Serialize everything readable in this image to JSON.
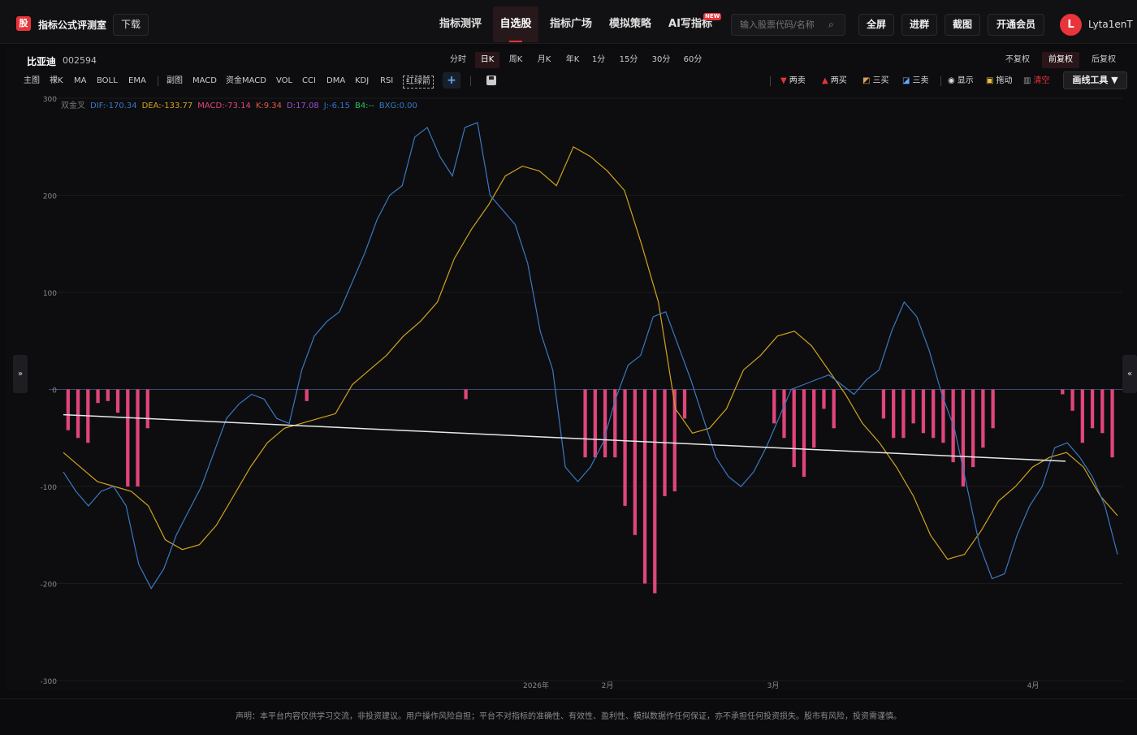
{
  "header": {
    "logo_char": "股",
    "brand": "指标公式评测室",
    "download": "下载",
    "nav": [
      "指标测评",
      "自选股",
      "指标广场",
      "模拟策略",
      "AI写指标"
    ],
    "nav_active": "自选股",
    "new_badge": "NEW",
    "search_placeholder": "输入股票代码/名称",
    "buttons": [
      "全屏",
      "进群",
      "截图",
      "开通会员"
    ],
    "avatar_letter": "L",
    "username": "Lyta1enT"
  },
  "stock": {
    "name": "比亚迪",
    "code": "002594"
  },
  "periods": [
    "分时",
    "日K",
    "周K",
    "月K",
    "年K",
    "1分",
    "15分",
    "30分",
    "60分"
  ],
  "period_active": "日K",
  "fuquan": [
    "不复权",
    "前复权",
    "后复权"
  ],
  "fuquan_active": "前复权",
  "indicators": [
    "主图",
    "裸K",
    "MA",
    "BOLL",
    "EMA",
    "副图",
    "MACD",
    "资金MACD",
    "VOL",
    "CCI",
    "DMA",
    "KDJ",
    "RSI",
    "红绿箭"
  ],
  "tools": {
    "two_sell": "两卖",
    "two_buy": "两买",
    "three_buy": "三买",
    "three_sell": "三卖",
    "show": "显示",
    "drag": "拖动",
    "clear": "清空",
    "draw_tools": "画线工具 ▼"
  },
  "legend": {
    "name": "双金叉",
    "dif": "DIF:-170.34",
    "dea": "DEA:-133.77",
    "macd": "MACD:-73.14",
    "k": "K:9.34",
    "d": "D:17.08",
    "j": "J:-6.15",
    "b4": "B4:--",
    "bxg": "BXG:0.00"
  },
  "colors": {
    "accent": "#e8343a",
    "dif": "#3a78c2",
    "dea": "#d2a21e",
    "macd": "#e0457b",
    "k": "#e05a4a",
    "d": "#9a4fd0",
    "j": "#3a6fd0",
    "b4": "#22c55e",
    "bxg": "#3a78c2"
  },
  "side_left": "»",
  "side_right": "«",
  "footer": "声明：本平台内容仅供学习交流，非投资建议。用户操作风险自担；平台不对指标的准确性、有效性、盈利性、模拟数据作任何保证，亦不承担任何投资损失。股市有风险，投资需谨慎。",
  "chart_data": {
    "type": "line",
    "y_ticks": [
      "300",
      "200",
      "100",
      "0",
      "-100",
      "-200",
      "-300"
    ],
    "ylim": [
      -300,
      300
    ],
    "x_labels": [
      "2026年",
      "2月",
      "3月",
      "4月"
    ],
    "macd_bars": [
      -42,
      -50,
      -55,
      -14,
      -12,
      -24,
      -100,
      -100,
      -40,
      0,
      0,
      0,
      0,
      0,
      0,
      0,
      0,
      0,
      0,
      0,
      0,
      0,
      0,
      0,
      -12,
      0,
      0,
      0,
      0,
      0,
      0,
      0,
      0,
      0,
      0,
      0,
      0,
      0,
      0,
      0,
      -10,
      0,
      0,
      0,
      0,
      0,
      0,
      0,
      0,
      0,
      0,
      0,
      -70,
      -70,
      -70,
      -70,
      -120,
      -150,
      -200,
      -210,
      -110,
      -105,
      -30,
      0,
      0,
      0,
      0,
      0,
      0,
      0,
      0,
      -35,
      -50,
      -80,
      -90,
      -60,
      -20,
      -40,
      0,
      0,
      0,
      0,
      -30,
      -50,
      -50,
      -35,
      -45,
      -50,
      -55,
      -75,
      -100,
      -80,
      -60,
      -40,
      0,
      0,
      0,
      0,
      0,
      0,
      -5,
      -22,
      -55,
      -40,
      -45,
      -70
    ],
    "dif": [
      -85,
      -105,
      -120,
      -105,
      -100,
      -120,
      -180,
      -205,
      -185,
      -150,
      -125,
      -100,
      -65,
      -30,
      -15,
      -5,
      -10,
      -30,
      -35,
      20,
      55,
      70,
      80,
      110,
      140,
      175,
      200,
      210,
      260,
      270,
      240,
      220,
      270,
      275,
      200,
      185,
      170,
      130,
      60,
      20,
      -80,
      -95,
      -80,
      -55,
      -10,
      25,
      35,
      75,
      80,
      45,
      10,
      -30,
      -70,
      -90,
      -100,
      -85,
      -60,
      -30,
      0,
      5,
      10,
      15,
      5,
      -5,
      10,
      20,
      60,
      90,
      75,
      40,
      -5,
      -40,
      -100,
      -160,
      -195,
      -190,
      -150,
      -120,
      -100,
      -60,
      -55,
      -70,
      -90,
      -120,
      -170
    ],
    "dea": [
      -65,
      -80,
      -95,
      -100,
      -105,
      -120,
      -155,
      -165,
      -160,
      -140,
      -110,
      -80,
      -55,
      -40,
      -35,
      -30,
      -25,
      5,
      20,
      35,
      55,
      70,
      90,
      135,
      165,
      190,
      220,
      230,
      225,
      210,
      250,
      240,
      225,
      205,
      150,
      90,
      -20,
      -45,
      -40,
      -20,
      20,
      35,
      55,
      60,
      45,
      20,
      -5,
      -35,
      -55,
      -80,
      -110,
      -150,
      -175,
      -170,
      -145,
      -115,
      -100,
      -80,
      -70,
      -65,
      -80,
      -110,
      -130
    ]
  }
}
